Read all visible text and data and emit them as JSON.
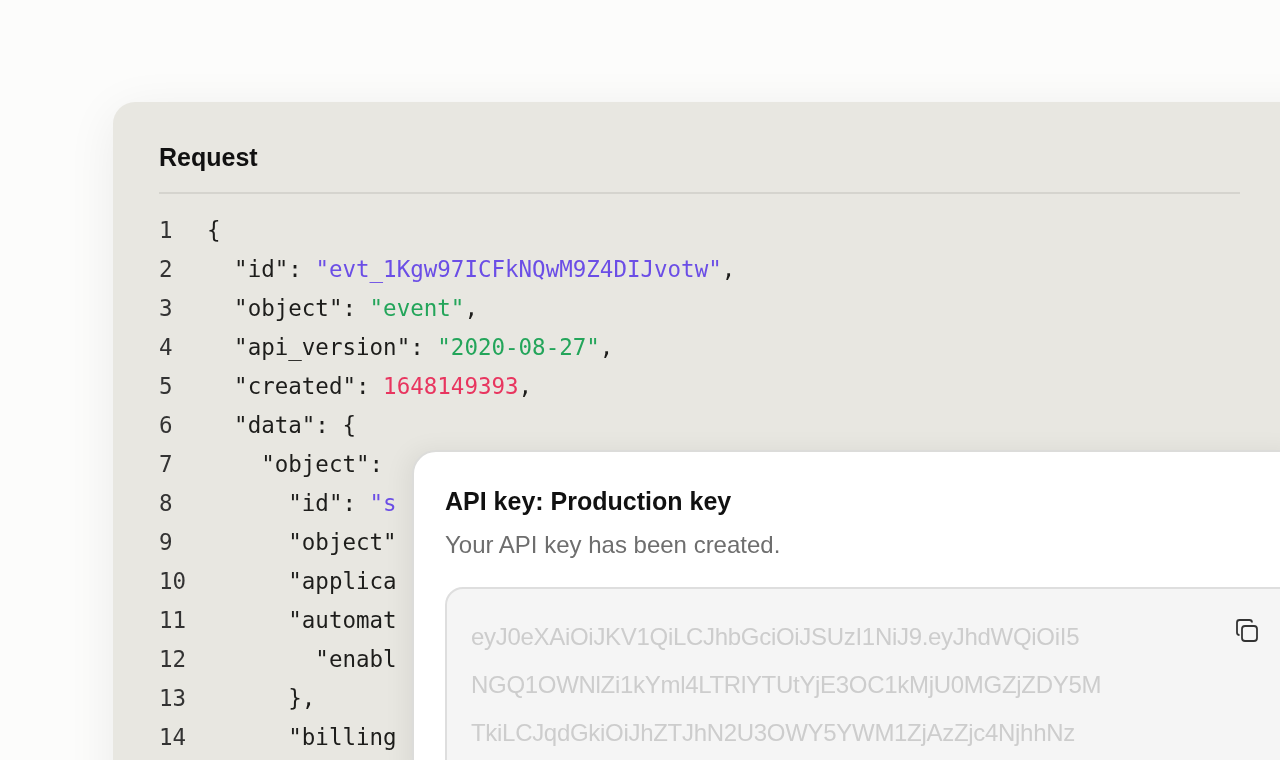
{
  "request": {
    "title": "Request",
    "lines": [
      {
        "number": "1",
        "tokens": [
          {
            "kind": "plain",
            "text": "{"
          }
        ]
      },
      {
        "number": "2",
        "tokens": [
          {
            "kind": "plain",
            "text": "  \"id\": "
          },
          {
            "kind": "id",
            "text": "\"evt_1Kgw97ICFkNQwM9Z4DIJvotw\""
          },
          {
            "kind": "plain",
            "text": ","
          }
        ]
      },
      {
        "number": "3",
        "tokens": [
          {
            "kind": "plain",
            "text": "  \"object\": "
          },
          {
            "kind": "string",
            "text": "\"event\""
          },
          {
            "kind": "plain",
            "text": ","
          }
        ]
      },
      {
        "number": "4",
        "tokens": [
          {
            "kind": "plain",
            "text": "  \"api_version\": "
          },
          {
            "kind": "string",
            "text": "\"2020-08-27\""
          },
          {
            "kind": "plain",
            "text": ","
          }
        ]
      },
      {
        "number": "5",
        "tokens": [
          {
            "kind": "plain",
            "text": "  \"created\": "
          },
          {
            "kind": "number",
            "text": "1648149393"
          },
          {
            "kind": "plain",
            "text": ","
          }
        ]
      },
      {
        "number": "6",
        "tokens": [
          {
            "kind": "plain",
            "text": "  \"data\": {"
          }
        ]
      },
      {
        "number": "7",
        "tokens": [
          {
            "kind": "plain",
            "text": "    \"object\":"
          }
        ]
      },
      {
        "number": "8",
        "tokens": [
          {
            "kind": "plain",
            "text": "      \"id\": "
          },
          {
            "kind": "id",
            "text": "\"s"
          }
        ]
      },
      {
        "number": "9",
        "tokens": [
          {
            "kind": "plain",
            "text": "      \"object\""
          }
        ]
      },
      {
        "number": "10",
        "tokens": [
          {
            "kind": "plain",
            "text": "      \"applica"
          }
        ]
      },
      {
        "number": "11",
        "tokens": [
          {
            "kind": "plain",
            "text": "      \"automat"
          }
        ]
      },
      {
        "number": "12",
        "tokens": [
          {
            "kind": "plain",
            "text": "        \"enabl"
          }
        ]
      },
      {
        "number": "13",
        "tokens": [
          {
            "kind": "plain",
            "text": "      },"
          }
        ]
      },
      {
        "number": "14",
        "tokens": [
          {
            "kind": "plain",
            "text": "      \"billing"
          }
        ]
      }
    ]
  },
  "dialog": {
    "title": "API key: Production key",
    "message": "Your API key has been created.",
    "key_lines": [
      "eyJ0eXAiOiJKV1QiLCJhbGciOiJSUzI1NiJ9.eyJhdWQiOiI5",
      "NGQ1OWNlZi1kYml4LTRlYTUtYjE3OC1kMjU0MGZjZDY5M",
      "TkiLCJqdGkiOiJhZTJhN2U3OWY5YWM1ZjAzZjc4NjhhNz"
    ]
  }
}
